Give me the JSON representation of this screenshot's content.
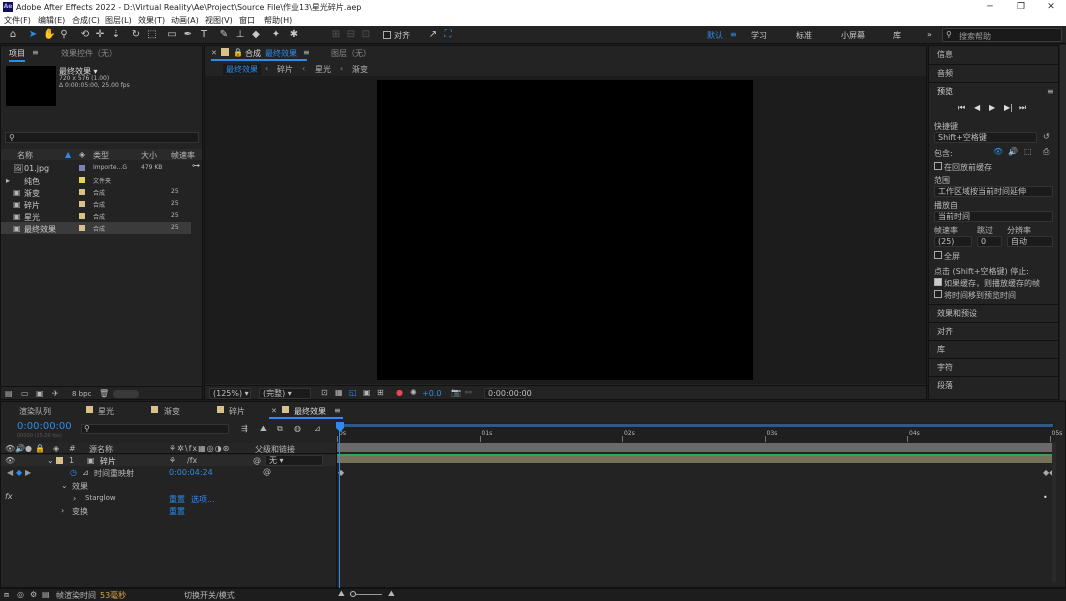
{
  "title": "Adobe After Effects 2022 - D:\\Virtual Reality\\Ae\\Project\\Source File\\作业13\\星光碎片.aep",
  "menu": [
    "文件(F)",
    "编辑(E)",
    "合成(C)",
    "图层(L)",
    "效果(T)",
    "动画(A)",
    "视图(V)",
    "窗口",
    "帮助(H)"
  ],
  "toolbar": {
    "snap_label": "对齐"
  },
  "workspaces": {
    "default": "默认",
    "learn": "学习",
    "standard": "标准",
    "small": "小屏幕",
    "library": "库"
  },
  "help_placeholder": "搜索帮助",
  "project": {
    "tab_project": "项目",
    "tab_effects": "效果控件（无）",
    "selected_name": "最终效果",
    "selected_info1": "720 x 576 (1.00)",
    "selected_info2": "Δ 0:00:05:00, 25.00 fps",
    "cols": {
      "name": "名称",
      "type": "类型",
      "size": "大小",
      "fps": "帧速率"
    },
    "items": [
      {
        "name": "01.jpg",
        "type": "Importe...G",
        "size": "479 KB",
        "fps": "",
        "color": "#7f7fb8"
      },
      {
        "name": "纯色",
        "type": "文件夹",
        "size": "",
        "fps": "",
        "color": "#e0d45a"
      },
      {
        "name": "渐变",
        "type": "合成",
        "size": "",
        "fps": "25",
        "color": "#d8c18a"
      },
      {
        "name": "碎片",
        "type": "合成",
        "size": "",
        "fps": "25",
        "color": "#d8c18a"
      },
      {
        "name": "星光",
        "type": "合成",
        "size": "",
        "fps": "25",
        "color": "#d8c18a"
      },
      {
        "name": "最终效果",
        "type": "合成",
        "size": "",
        "fps": "25",
        "color": "#d8c18a"
      }
    ],
    "bpc": "8 bpc"
  },
  "comp": {
    "tab_label": "合成",
    "tab_name": "最终效果",
    "layer_tab": "图层（无）",
    "breadcrumbs": [
      "最终效果",
      "碎片",
      "星光",
      "渐变"
    ],
    "zoom": "(125%)",
    "resolution": "(完整)",
    "exposure": "+0.0",
    "timecode": "0:00:00:00"
  },
  "right": {
    "info": "信息",
    "audio": "音频",
    "preview": "预览",
    "shortcut_label": "快捷键",
    "shortcut": "Shift+空格键",
    "include": "包含:",
    "cache_before": "在回放前缓存",
    "range_label": "范围",
    "range": "工作区域按当前时间延伸",
    "play_from_label": "播放自",
    "play_from": "当前时间",
    "fps_label": "帧速率",
    "skip_label": "跳过",
    "res_label": "分辨率",
    "fps": "(25)",
    "skip": "0",
    "res": "自动",
    "fullscreen": "全屏",
    "stop_label": "点击 (Shift+空格键) 停止:",
    "opt1": "如果缓存，则播放缓存的帧",
    "opt2": "将时间移到预览时间",
    "effects": "效果和预设",
    "align": "对齐",
    "library": "库",
    "character": "字符",
    "paragraph": "段落"
  },
  "timeline": {
    "tabs": [
      "渲染队列",
      "星光",
      "渐变",
      "碎片",
      "最终效果"
    ],
    "timecode": "0:00:00:00",
    "fps_sub": "00000 (25.00 fps)",
    "col_source": "源名称",
    "col_parent": "父级和链接",
    "layer_num": "1",
    "layer_name": "碎片",
    "parent": "无",
    "remap": "时间重映射",
    "remap_value": "0:00:04:24",
    "effects": "效果",
    "starglow": "Starglow",
    "reset": "重置",
    "options": "选项...",
    "transform": "变换",
    "reset2": "重置",
    "ticks": [
      "0s",
      "01s",
      "02s",
      "03s",
      "04s",
      "05s"
    ],
    "status_label": "帧渲染时间",
    "status_value": "53毫秒",
    "switch": "切换开关/模式"
  }
}
